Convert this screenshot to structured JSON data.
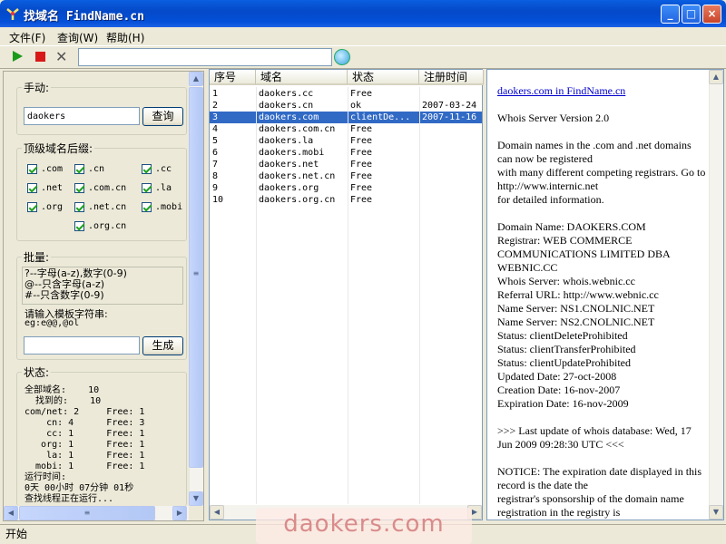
{
  "window": {
    "title": "找域名 FindName.cn",
    "min": "_",
    "max": "□",
    "close": "×"
  },
  "menu": [
    "文件(F)",
    "查询(W)",
    "帮助(H)"
  ],
  "toolbar": {
    "url_value": ""
  },
  "manual": {
    "title": "手动:",
    "input_value": "daokers",
    "query_button": "查询"
  },
  "tld": {
    "title": "顶级域名后缀:",
    "options": [
      ".com",
      ".cn",
      ".cc",
      ".net",
      ".com.cn",
      ".la",
      ".org",
      ".net.cn",
      ".mobi",
      ".org.cn"
    ]
  },
  "batch": {
    "title": "批量:",
    "rules": [
      "?--字母(a-z),数字(0-9)",
      "@--只含字母(a-z)",
      "#--只含数字(0-9)"
    ],
    "template_label": "请输入模板字符串:",
    "example": "eg:e@@,@ol",
    "template_value": "",
    "generate_button": "生成"
  },
  "status": {
    "title": "状态:",
    "lines": [
      "全部域名:    10",
      "  找到的:    10",
      "com/net: 2     Free: 1",
      "    cn: 4      Free: 3",
      "    cc: 1      Free: 1",
      "   org: 1      Free: 1",
      "    la: 1      Free: 1",
      "  mobi: 1      Free: 1",
      "运行时间:",
      "0天 00小时 07分钟 01秒",
      "查找线程正在运行..."
    ]
  },
  "list": {
    "columns": [
      "序号",
      "域名",
      "状态",
      "注册时间"
    ],
    "rows": [
      [
        "1",
        "daokers.cc",
        "Free",
        ""
      ],
      [
        "2",
        "daokers.cn",
        "ok",
        "2007-03-24"
      ],
      [
        "3",
        "daokers.com",
        "clientDe...",
        "2007-11-16"
      ],
      [
        "4",
        "daokers.com.cn",
        "Free",
        ""
      ],
      [
        "5",
        "daokers.la",
        "Free",
        ""
      ],
      [
        "6",
        "daokers.mobi",
        "Free",
        ""
      ],
      [
        "7",
        "daokers.net",
        "Free",
        ""
      ],
      [
        "8",
        "daokers.net.cn",
        "Free",
        ""
      ],
      [
        "9",
        "daokers.org",
        "Free",
        ""
      ],
      [
        "10",
        "daokers.org.cn",
        "Free",
        ""
      ]
    ],
    "selected_row": 2
  },
  "detail": {
    "link": "daokers.com in FindName.cn",
    "paragraphs": [
      "Whois Server Version 2.0",
      "Domain names in the .com and .net domains can now be registered\nwith many different competing registrars. Go to http://www.internic.net\nfor detailed information.",
      "Domain Name: DAOKERS.COM\nRegistrar: WEB COMMERCE COMMUNICATIONS LIMITED DBA WEBNIC.CC\nWhois Server: whois.webnic.cc\nReferral URL: http://www.webnic.cc\nName Server: NS1.CNOLNIC.NET\nName Server: NS2.CNOLNIC.NET\nStatus: clientDeleteProhibited\nStatus: clientTransferProhibited\nStatus: clientUpdateProhibited\nUpdated Date: 27-oct-2008\nCreation Date: 16-nov-2007\nExpiration Date: 16-nov-2009",
      ">>> Last update of whois database: Wed, 17 Jun 2009 09:28:30 UTC <<<",
      "NOTICE: The expiration date displayed in this record is the date the\nregistrar's sponsorship of the domain name registration in the registry is"
    ]
  },
  "statusbar": {
    "text": "开始"
  },
  "watermark": "daokers.com"
}
